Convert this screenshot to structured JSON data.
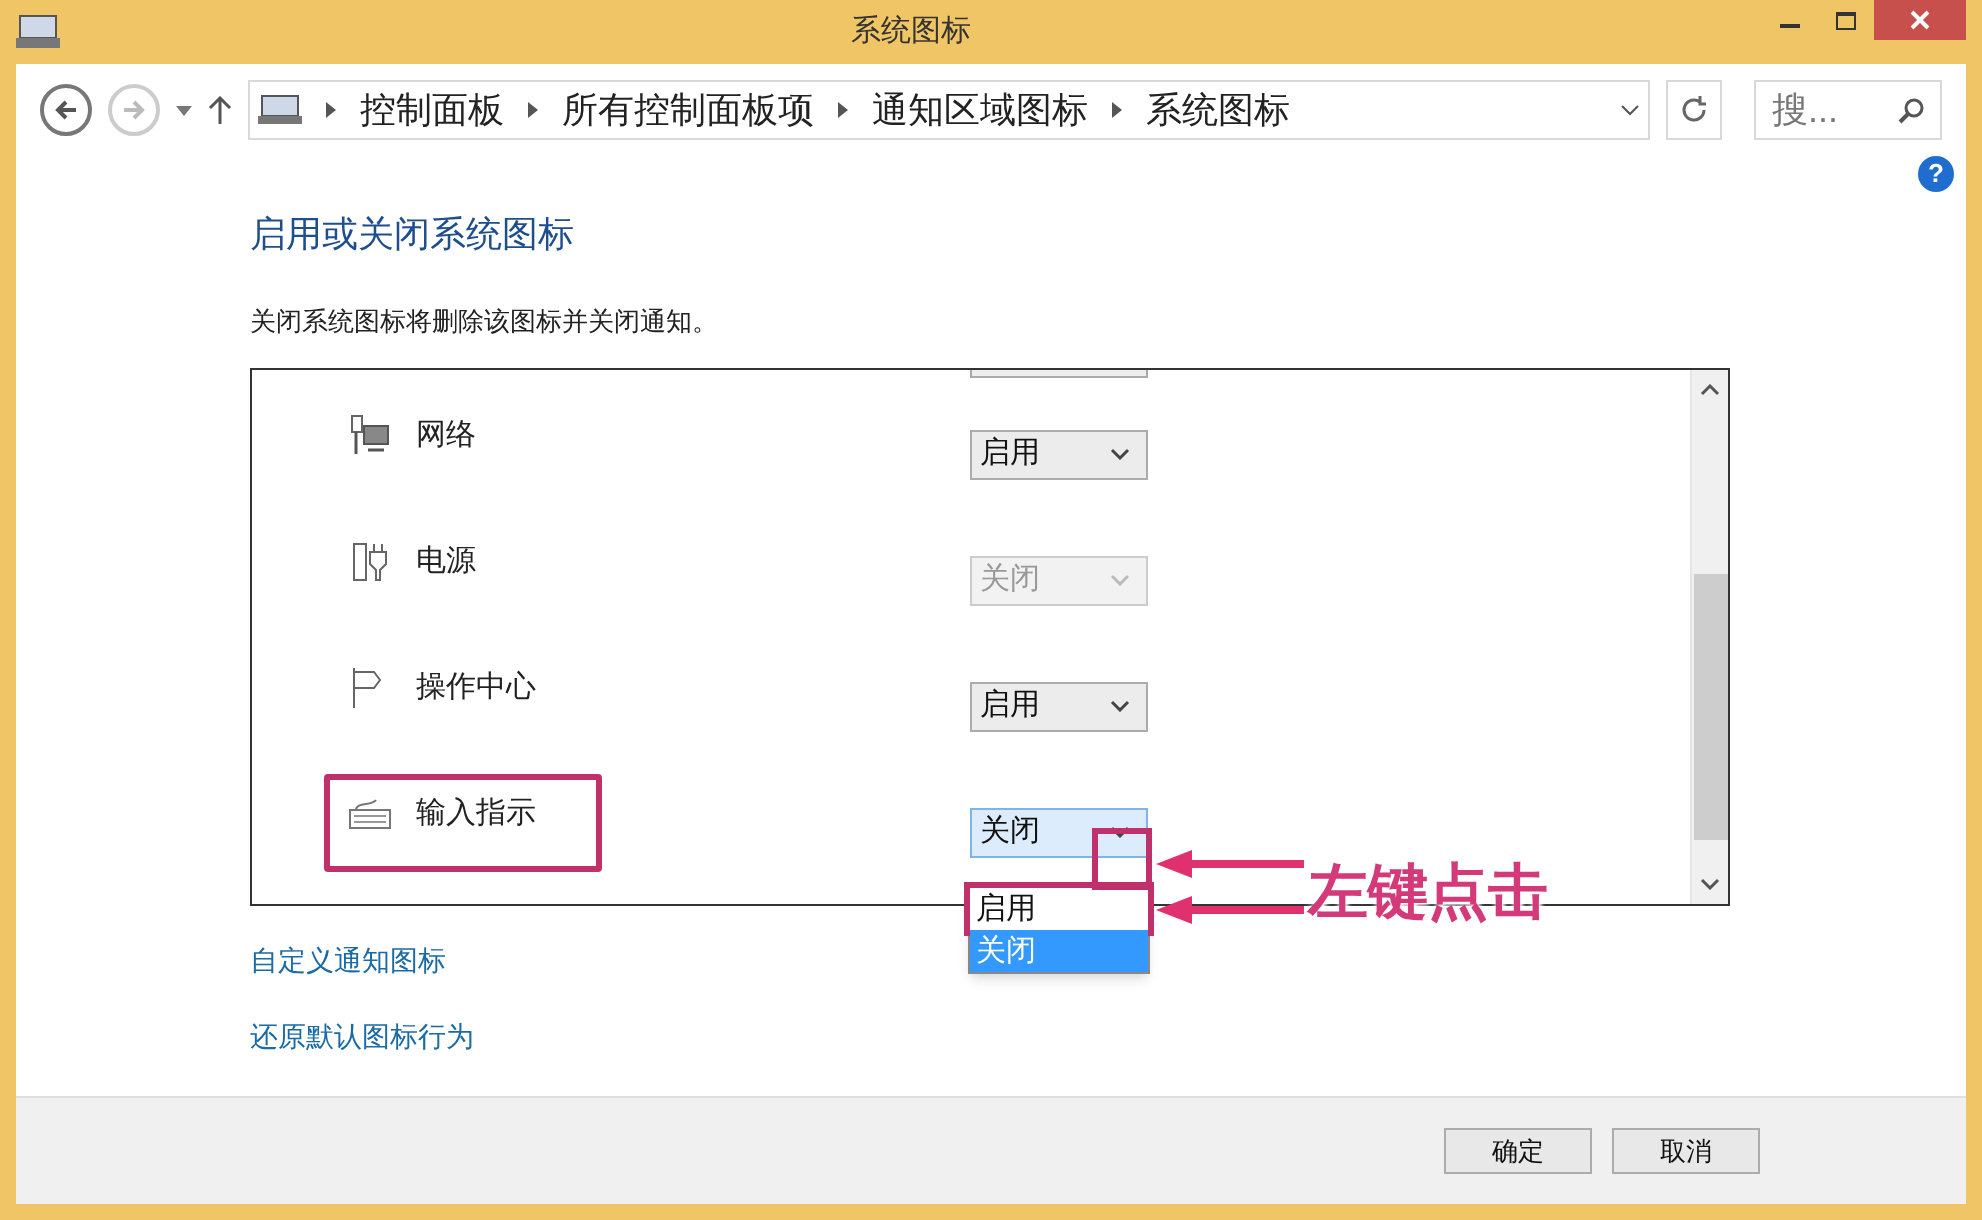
{
  "window": {
    "title": "系统图标"
  },
  "nav": {
    "breadcrumb": [
      "控制面板",
      "所有控制面板项",
      "通知区域图标",
      "系统图标"
    ],
    "search": {
      "placeholder": "搜..."
    }
  },
  "help": "?",
  "heading": "启用或关闭系统图标",
  "description": "关闭系统图标将删除该图标并关闭通知。",
  "icons": [
    {
      "kind": "network",
      "name": "网络",
      "value": "启用",
      "disabled": false,
      "expanded": false,
      "highlighted": false
    },
    {
      "kind": "power",
      "name": "电源",
      "value": "关闭",
      "disabled": true,
      "expanded": false,
      "highlighted": false
    },
    {
      "kind": "flag",
      "name": "操作中心",
      "value": "启用",
      "disabled": false,
      "expanded": false,
      "highlighted": false
    },
    {
      "kind": "keyboard",
      "name": "输入指示",
      "value": "关闭",
      "disabled": false,
      "expanded": true,
      "highlighted": true
    }
  ],
  "dropdown_options": [
    {
      "label": "启用",
      "selected": false,
      "highlighted": true
    },
    {
      "label": "关闭",
      "selected": true,
      "highlighted": false
    }
  ],
  "links": [
    "自定义通知图标",
    "还原默认图标行为"
  ],
  "buttons": [
    "确定",
    "取消"
  ],
  "annotation": {
    "text": "左键点击"
  }
}
